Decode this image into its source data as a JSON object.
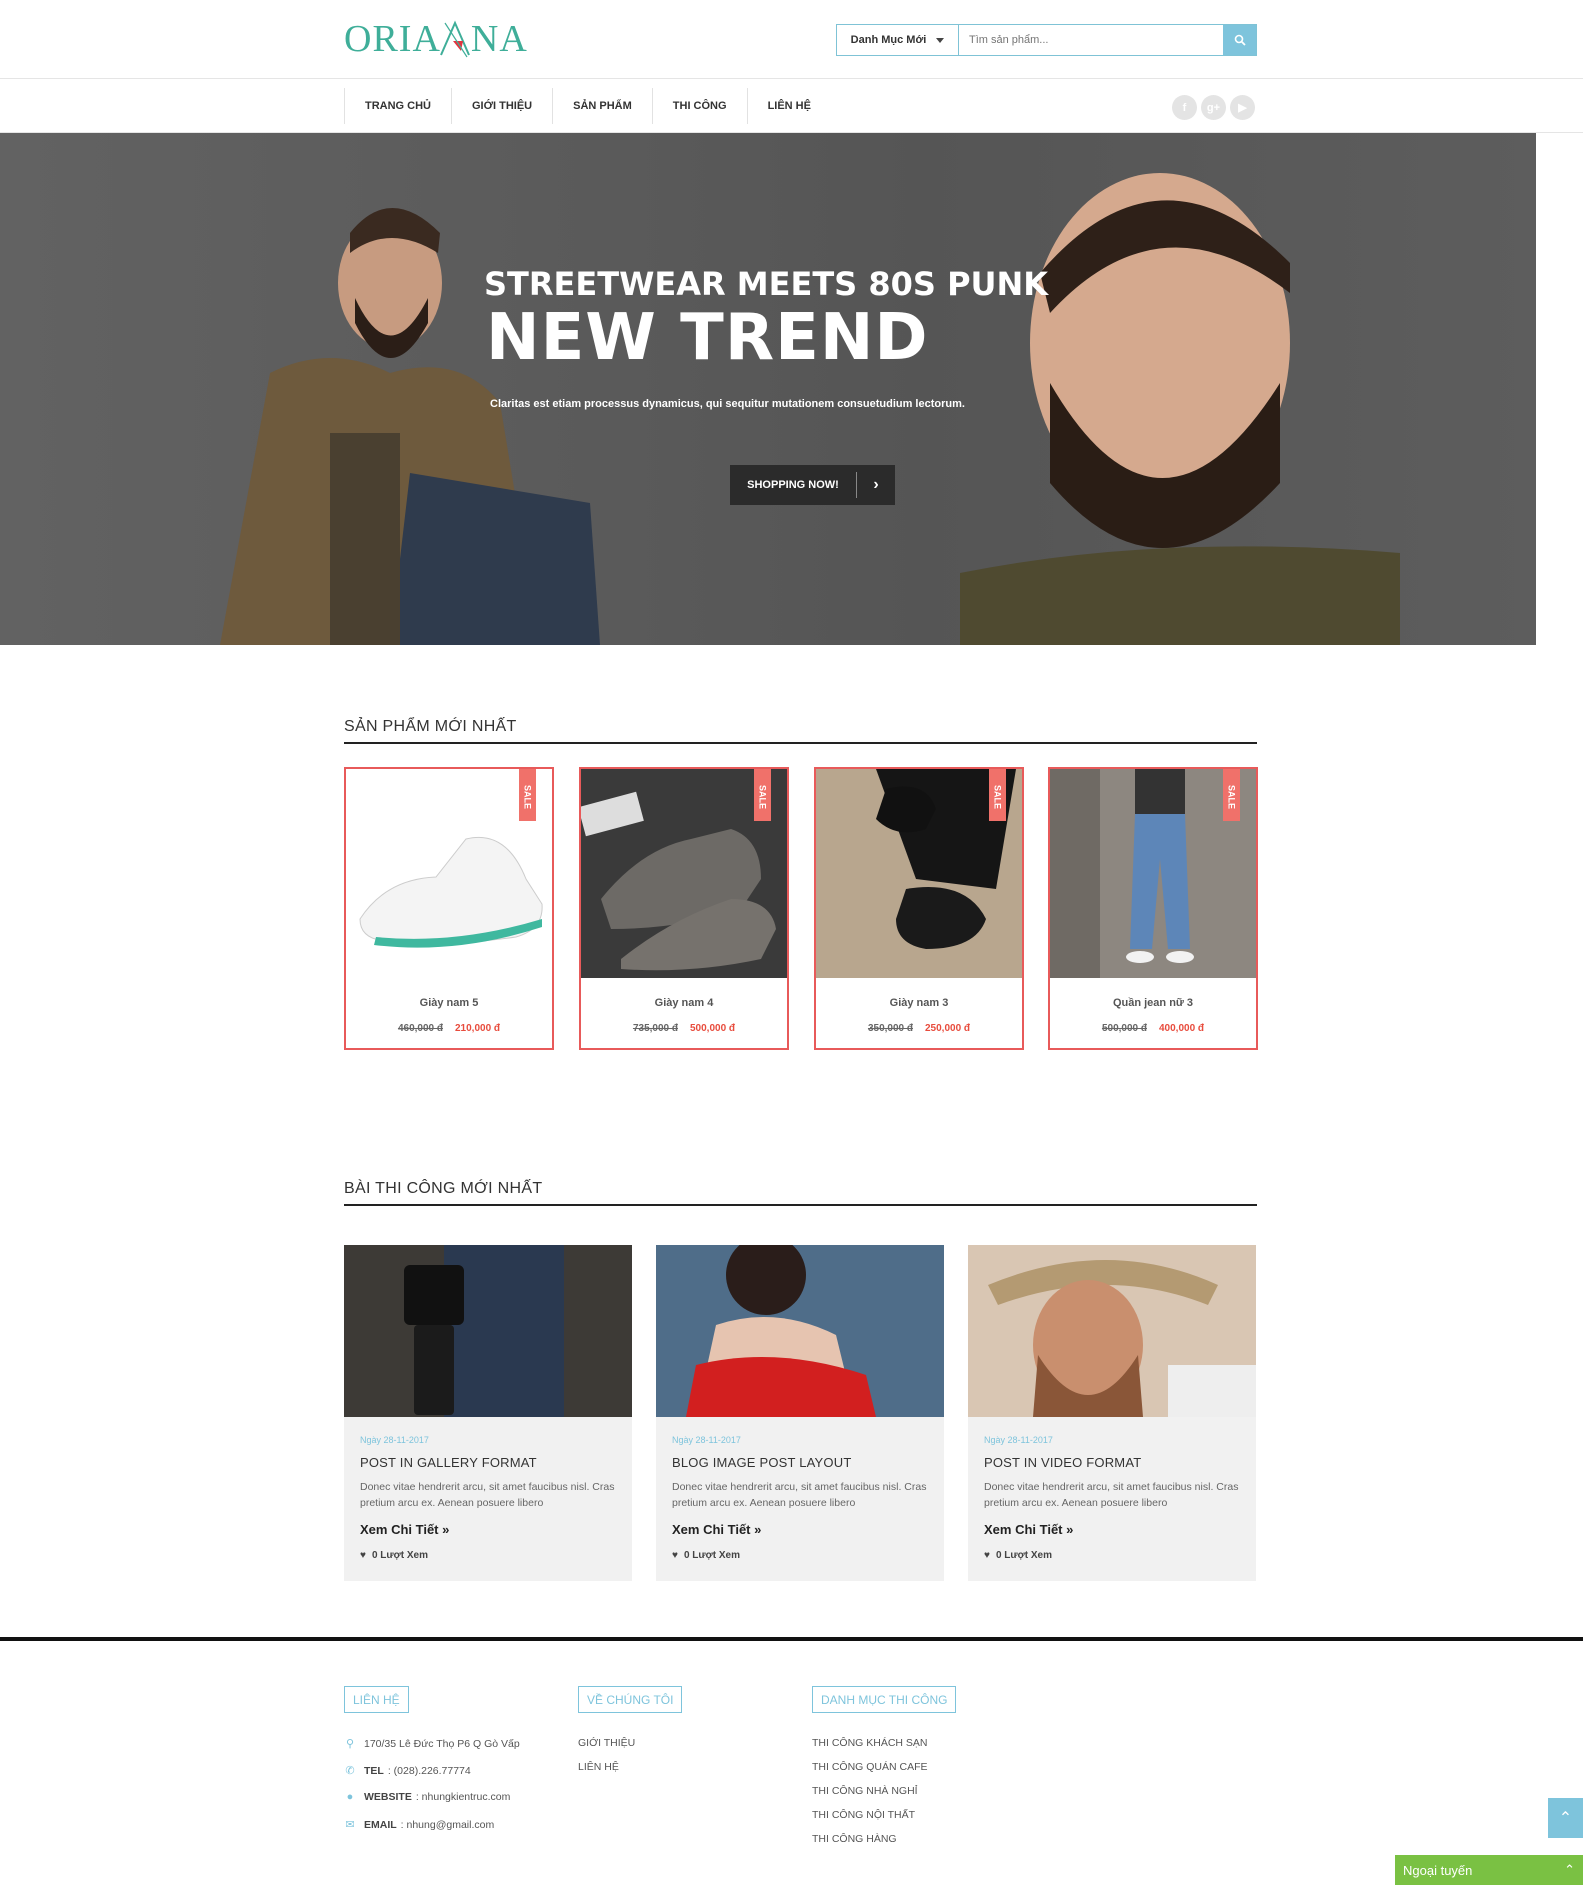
{
  "header": {
    "logo_text_left": "ORIA",
    "logo_text_right": "NA",
    "category_select": "Danh Mục Mới",
    "search_placeholder": "Tìm sản phẩm..."
  },
  "nav": {
    "items": [
      {
        "label": "TRANG CHỦ"
      },
      {
        "label": "GIỚI THIỆU"
      },
      {
        "label": "SẢN PHẨM"
      },
      {
        "label": "THI CÔNG"
      },
      {
        "label": "LIÊN HỆ"
      }
    ],
    "social": [
      "f",
      "g+",
      "▶"
    ]
  },
  "hero": {
    "line1": "STREETWEAR MEETS 80S PUNK",
    "line2": "NEW TREND",
    "line3": "Claritas est etiam processus dynamicus, qui sequitur mutationem consuetudium lectorum.",
    "button": "SHOPPING NOW!",
    "button_arrow": "›"
  },
  "products_section": {
    "title": "SẢN PHẨM MỚI NHẤT",
    "sale_label": "SALE",
    "items": [
      {
        "name": "Giày nam 5",
        "old_price": "460,000 đ",
        "price": "210,000 đ"
      },
      {
        "name": "Giày nam 4",
        "old_price": "735,000 đ",
        "price": "500,000 đ"
      },
      {
        "name": "Giày nam 3",
        "old_price": "350,000 đ",
        "price": "250,000 đ"
      },
      {
        "name": "Quần jean nữ 3",
        "old_price": "500,000 đ",
        "price": "400,000 đ"
      }
    ]
  },
  "posts_section": {
    "title": "BÀI THI CÔNG MỚI NHẤT",
    "items": [
      {
        "date": "Ngày 28-11-2017",
        "title": "POST IN GALLERY FORMAT",
        "desc": "Donec vitae hendrerit arcu, sit amet faucibus nisl. Cras pretium arcu ex. Aenean posuere libero",
        "more": "Xem Chi Tiết",
        "views": "0 Lượt Xem"
      },
      {
        "date": "Ngày 28-11-2017",
        "title": "BLOG IMAGE POST LAYOUT",
        "desc": "Donec vitae hendrerit arcu, sit amet faucibus nisl. Cras pretium arcu ex. Aenean posuere libero",
        "more": "Xem Chi Tiết",
        "views": "0 Lượt Xem"
      },
      {
        "date": "Ngày 28-11-2017",
        "title": "POST IN VIDEO FORMAT",
        "desc": "Donec vitae hendrerit arcu, sit amet faucibus nisl. Cras pretium arcu ex. Aenean posuere libero",
        "more": "Xem Chi Tiết",
        "views": "0 Lượt Xem"
      }
    ]
  },
  "footer": {
    "contact_title": "LIÊN HỆ",
    "address": "170/35 Lê Đức Thọ P6 Q Gò Vấp",
    "tel_label": "TEL",
    "tel": ": (028).226.77774",
    "website_label": "WEBSITE",
    "website": ": nhungkientruc.com",
    "email_label": "EMAIL",
    "email": ": nhung@gmail.com",
    "about_title": "VỀ CHÚNG TÔI",
    "about_links": [
      "GIỚI THIỆU",
      "LIÊN HỆ"
    ],
    "category_title": "DANH MỤC THI CÔNG",
    "category_links": [
      "THI CÔNG KHÁCH SẠN",
      "THI CÔNG QUÁN CAFE",
      "THI CÔNG NHÀ NGHỈ",
      "THI CÔNG NỘI THẤT",
      "THI CÔNG HÀNG"
    ]
  },
  "widgets": {
    "chat_label": "Ngoại tuyến",
    "chat_toggle": "⌃",
    "to_top": "⌃"
  }
}
